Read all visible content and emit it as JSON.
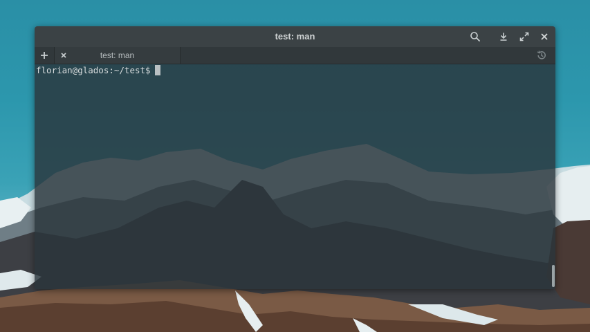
{
  "window": {
    "title": "test: man"
  },
  "tabs": [
    {
      "label": "test: man"
    }
  ],
  "terminal": {
    "prompt": "florian@glados:~/test$"
  },
  "icons": {
    "search": "search-icon",
    "download": "download-icon",
    "maximize": "maximize-icon",
    "close": "close-icon",
    "new_tab": "plus-icon",
    "tab_close": "close-icon",
    "history": "history-icon"
  },
  "colors": {
    "titlebar": "#3b4245",
    "tabbar": "#31383b",
    "terminal_bg": "#29343a",
    "text": "#d8dcdd",
    "sky": "#2c97ad"
  }
}
